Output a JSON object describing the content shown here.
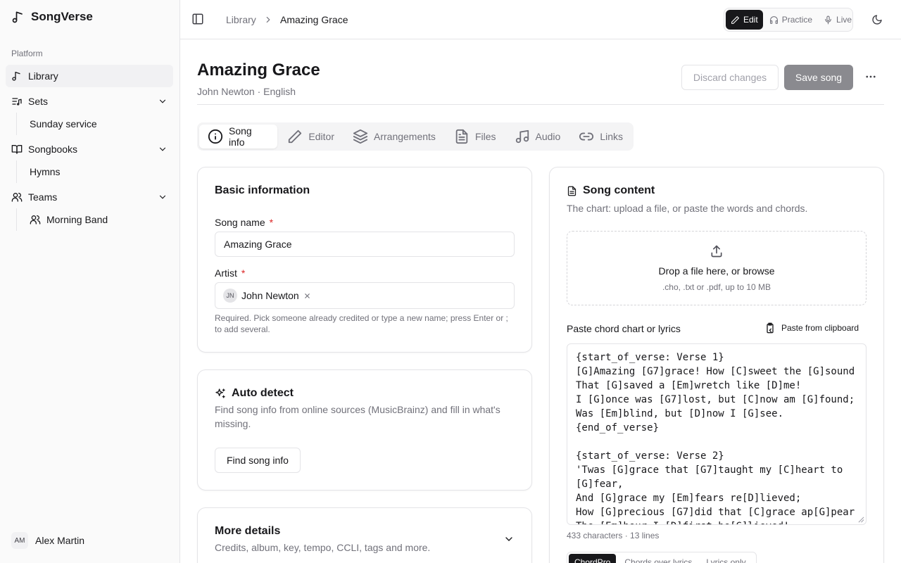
{
  "app": {
    "name": "SongVerse"
  },
  "sidebar": {
    "section": "Platform",
    "library": "Library",
    "sets": {
      "label": "Sets",
      "children": [
        "Sunday service"
      ]
    },
    "songbooks": {
      "label": "Songbooks",
      "children": [
        "Hymns"
      ]
    },
    "teams": {
      "label": "Teams",
      "children": [
        "Morning Band"
      ]
    },
    "user": {
      "initials": "AM",
      "name": "Alex Martin"
    }
  },
  "header": {
    "breadcrumb": [
      "Library",
      "Amazing Grace"
    ],
    "modes": [
      "Edit",
      "Practice",
      "Live"
    ],
    "active_mode": "Edit"
  },
  "song": {
    "title": "Amazing Grace",
    "subtitle": "John Newton · English",
    "discard_label": "Discard changes",
    "save_label": "Save song"
  },
  "tabs": [
    "Song info",
    "Editor",
    "Arrangements",
    "Files",
    "Audio",
    "Links"
  ],
  "basic_info": {
    "title": "Basic information",
    "name_label": "Song name",
    "name_value": "Amazing Grace",
    "artist_label": "Artist",
    "artist_chip": {
      "initials": "JN",
      "name": "John Newton"
    },
    "artist_hint": "Required. Pick someone already credited or type a new name; press Enter or ; to add several."
  },
  "auto_detect": {
    "title": "Auto detect",
    "desc": "Find song info from online sources (MusicBrainz) and fill in what's missing.",
    "button": "Find song info"
  },
  "more_details": {
    "title": "More details",
    "desc": "Credits, album, key, tempo, CCLI, tags and more."
  },
  "song_content": {
    "title": "Song content",
    "desc": "The chart: upload a file, or paste the words and chords.",
    "drop_title": "Drop a file here, or browse",
    "drop_sub": ".cho, .txt or .pdf, up to 10 MB",
    "paste_label": "Paste chord chart or lyrics",
    "paste_button": "Paste from clipboard",
    "chart_text": "{start_of_verse: Verse 1}\n[G]Amazing [G7]grace! How [C]sweet the [G]sound\nThat [G]saved a [Em]wretch like [D]me!\nI [G]once was [G7]lost, but [C]now am [G]found;\nWas [Em]blind, but [D]now I [G]see.\n{end_of_verse}\n\n{start_of_verse: Verse 2}\n'Twas [G]grace that [G7]taught my [C]heart to [G]fear,\nAnd [G]grace my [Em]fears re[D]lieved;\nHow [G]precious [G7]did that [C]grace ap[G]pear\nThe [Em]hour I [D]first be[G]lieved!\n{end_of_verse}",
    "stats": "433 characters · 13 lines",
    "formats": [
      "ChordPro",
      "Chords over lyrics",
      "Lyrics only"
    ],
    "active_format": "ChordPro"
  }
}
